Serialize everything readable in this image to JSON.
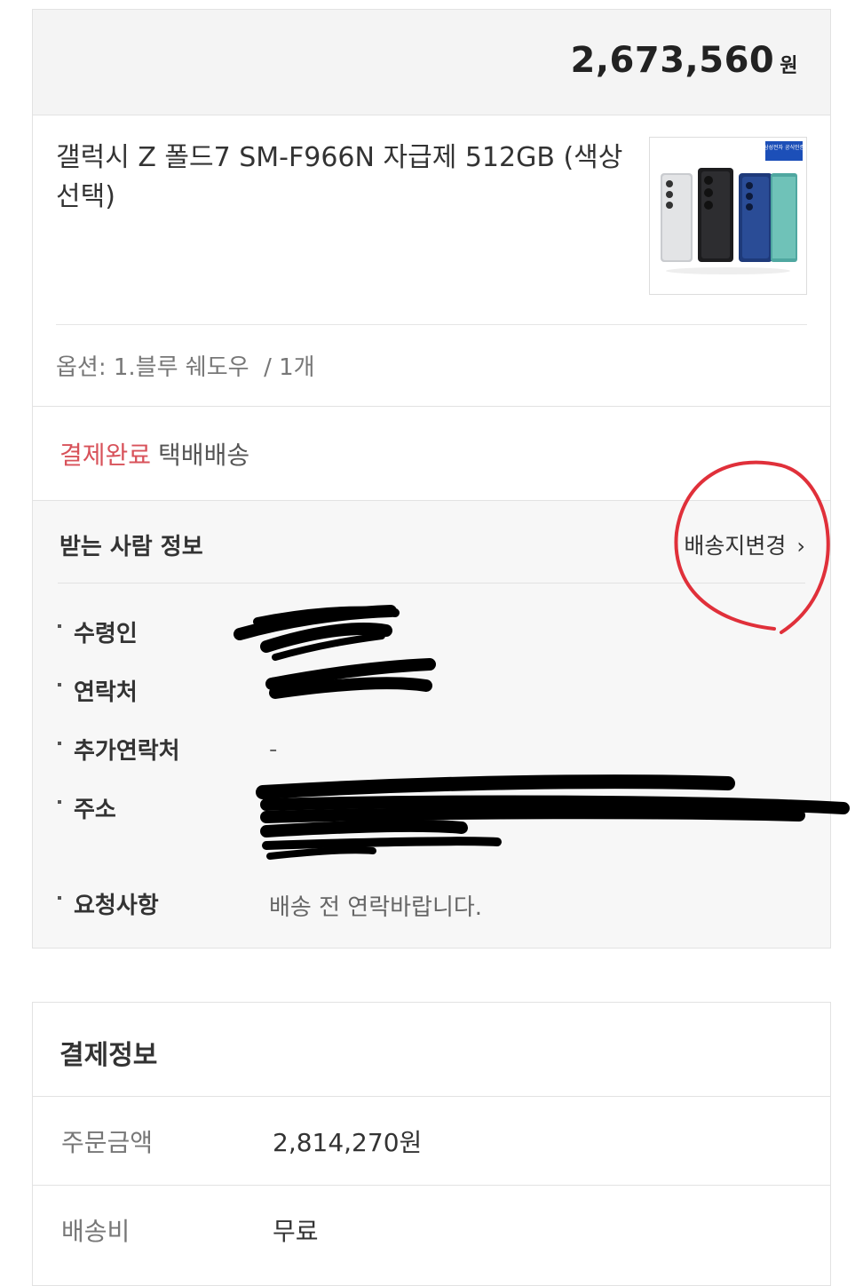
{
  "order": {
    "total_price": "2,673,560",
    "total_unit": "원",
    "product_name": "갤럭시 Z 폴드7 SM-F966N 자급제 512GB (색상선택)",
    "thumbnail_badge": "삼성전자 공식인증",
    "option": "옵션: 1.블루 쉐도우",
    "quantity": "/ 1개",
    "status": "결제완료",
    "delivery_type": "택배배송"
  },
  "receiver": {
    "title": "받는 사람 정보",
    "change_address": "배송지변경",
    "rows": [
      {
        "label": "수령인",
        "value": ""
      },
      {
        "label": "연락처",
        "value": ""
      },
      {
        "label": "추가연락처",
        "value": "-"
      },
      {
        "label": "주소",
        "value": ""
      },
      {
        "label": "요청사항",
        "value": "배송 전 연락바랍니다."
      }
    ]
  },
  "payment": {
    "title": "결제정보",
    "rows": [
      {
        "label": "주문금액",
        "value": "2,814,270원"
      },
      {
        "label": "배송비",
        "value": "무료"
      }
    ]
  },
  "colors": {
    "status_paid": "#d8525a",
    "annotation_circle": "#e0303a",
    "redaction": "#000000"
  }
}
